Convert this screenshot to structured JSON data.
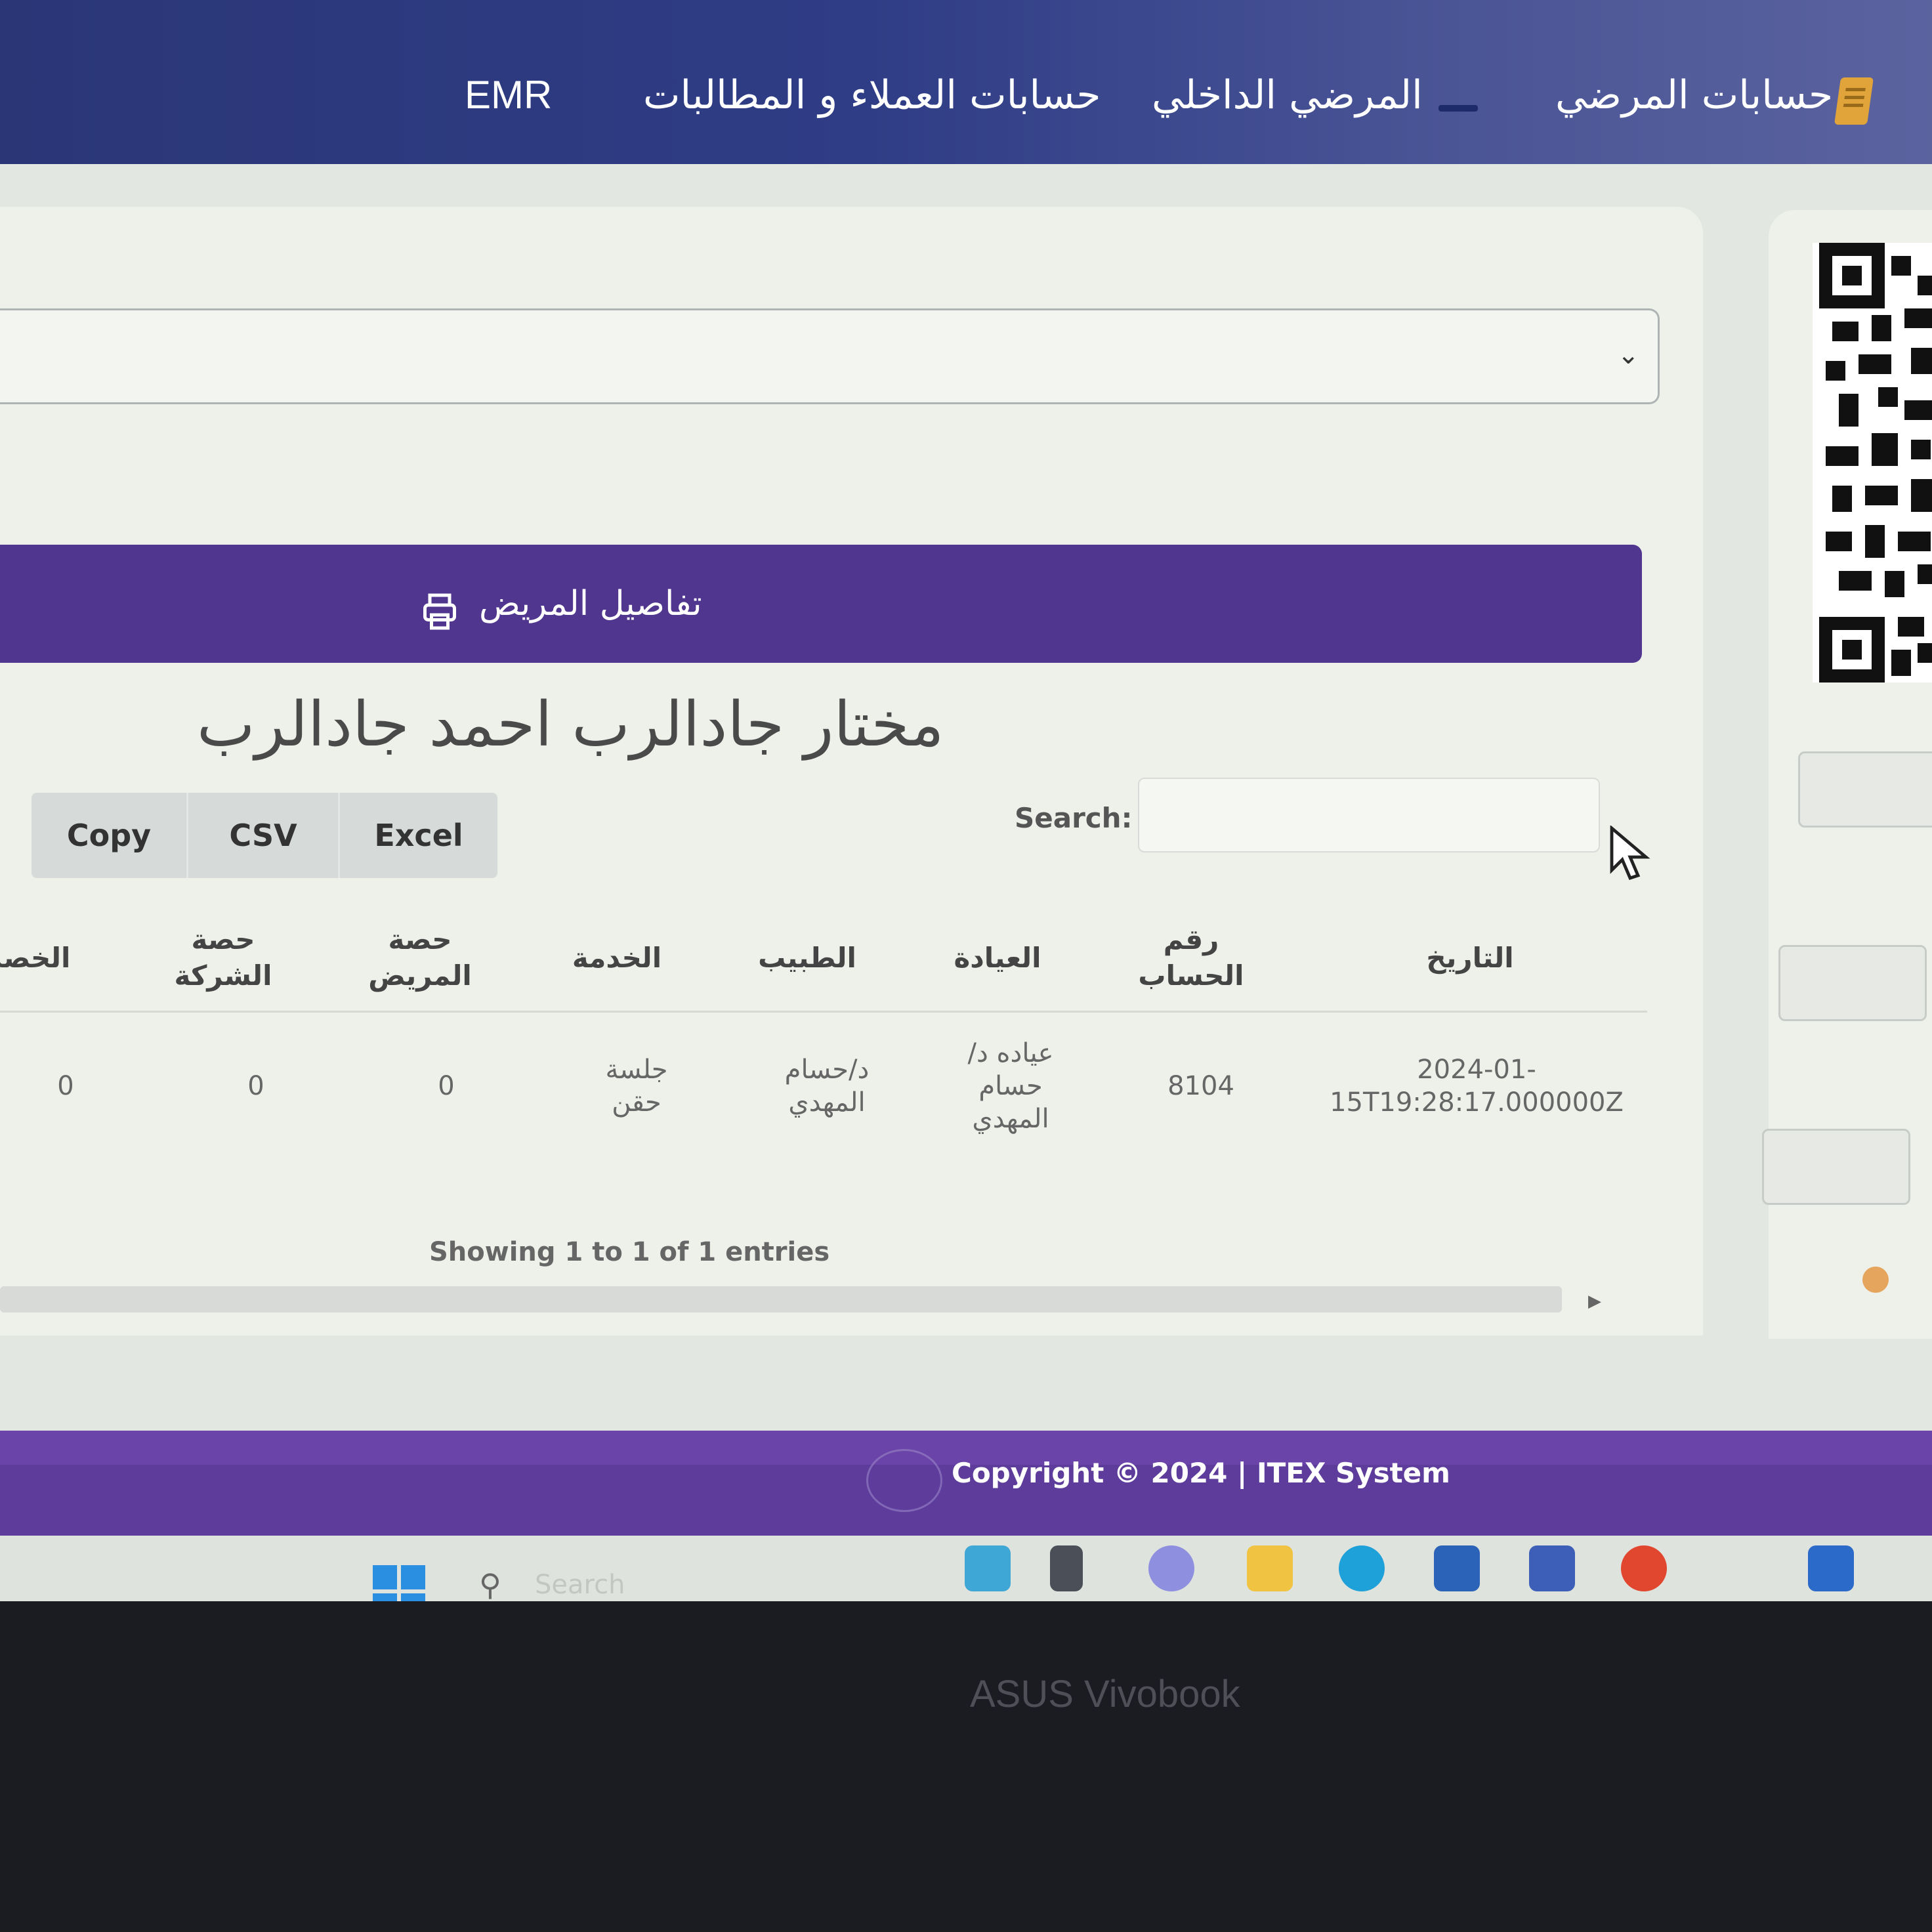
{
  "nav": {
    "emr": "EMR",
    "claims": "حسابات العملاء و المطالبات",
    "inpatient": "المرضي الداخلي",
    "patient_accounts": "حسابات المرضي"
  },
  "details_bar": {
    "title": "تفاصيل المريض",
    "icon": "printer-icon"
  },
  "patient_name": "مختار جادالرب احمد جادالرب",
  "export_buttons": {
    "copy": "Copy",
    "csv": "CSV",
    "excel": "Excel"
  },
  "search": {
    "label": "Search:",
    "value": ""
  },
  "table": {
    "headers": {
      "date": "التاريخ",
      "account_no": "رقم الحساب",
      "clinic": "العيادة",
      "doctor": "الطبيب",
      "service": "الخدمة",
      "patient_share": "حصة المريض",
      "company_share": "حصة الشركة",
      "discount": "الخصم"
    },
    "rows": [
      {
        "date": "2024-01-15T19:28:17.000000Z",
        "account_no": "8104",
        "clinic": "عياده د/ حسام المهدي",
        "doctor": "د/حسام المهدي",
        "service": "جلسة حقن",
        "patient_share": "0",
        "company_share": "0",
        "discount": "0"
      }
    ]
  },
  "showing": "Showing 1 to 1 of 1 entries",
  "footer": {
    "text": "Copyright © 2024 | ITEX System"
  },
  "taskbar": {
    "search_placeholder": "Search"
  },
  "device": {
    "brand": "ASUS Vivobook"
  },
  "colors": {
    "nav": "#2f3d86",
    "accent": "#51368f",
    "footer": "#5e3c9b"
  }
}
